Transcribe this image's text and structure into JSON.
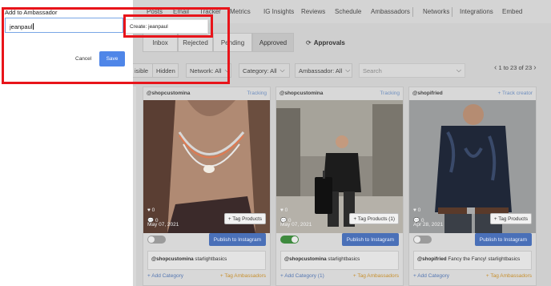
{
  "nav": {
    "items": [
      "Posts",
      "Email",
      "Tracker",
      "Metrics",
      "IG Insights",
      "Reviews",
      "Schedule",
      "Ambassadors",
      "Networks",
      "Integrations",
      "Embed"
    ]
  },
  "tabs": [
    "Inbox",
    "Rejected",
    "Pending",
    "Approved"
  ],
  "approvals_label": "Approvals",
  "filters": {
    "visible_label": "isible",
    "hidden_label": "Hidden",
    "network": "Network: All",
    "category": "Category: All",
    "ambassador": "Ambassador: All",
    "search_placeholder": "Search"
  },
  "pager": {
    "text": "1 to 23 of 23"
  },
  "cards": [
    {
      "user": "@shopcustomina",
      "tracking": "Tracking",
      "likes": "0",
      "comments": "0",
      "date": "May 07, 2021",
      "tag_products": "+ Tag Products",
      "toggle_on": false,
      "publish": "Publish to Instagram",
      "caption_user": "@shopcustomina",
      "caption_text": " starlightbasics",
      "add_category": "+ Add Category",
      "tag_ambassadors": "+ Tag Ambassadors"
    },
    {
      "user": "@shopcustomina",
      "tracking": "Tracking",
      "likes": "0",
      "comments": "0",
      "date": "May 07, 2021",
      "tag_products": "+ Tag Products (1)",
      "toggle_on": true,
      "publish": "Publish to Instagram",
      "caption_user": "@shopcustomina",
      "caption_text": " starlightbasics",
      "add_category": "+ Add Category (1)",
      "tag_ambassadors": "+ Tag Ambassadors"
    },
    {
      "user": "@shopifried",
      "tracking": "+ Track creator",
      "likes": "0",
      "comments": "0",
      "date": "Apr 28, 2021",
      "tag_products": "+ Tag Products",
      "toggle_on": false,
      "publish": "Publish to Instagram",
      "caption_user": "@shopifried",
      "caption_text": " Fancy the Fancy! starlightbasics",
      "add_category": "+ Add Category",
      "tag_ambassadors": "+ Tag Ambassadors"
    }
  ],
  "modal": {
    "title": "Add to Ambassador",
    "input_value": "jeanpaul",
    "suggestion": "Create:  jeanpaul",
    "cancel": "Cancel",
    "save": "Save"
  },
  "colors": {
    "highlight": "#e8141a",
    "save_button": "#4f86e8",
    "publish_button": "#4a70b8",
    "toggle_on": "#3e8a3e"
  }
}
